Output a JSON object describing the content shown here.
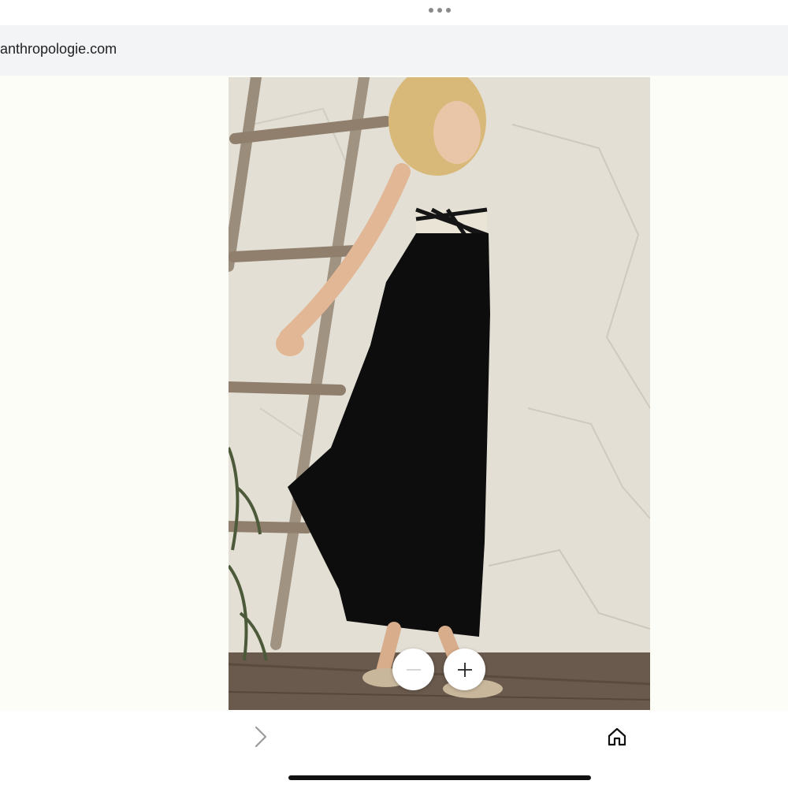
{
  "browser": {
    "url": "anthropologie.com",
    "menu_icon": "more-dots-icon"
  },
  "image_viewer": {
    "image_subject": "product-photo",
    "zoom_out_icon": "minus-icon",
    "zoom_in_icon": "plus-icon"
  },
  "toolbar": {
    "forward_icon": "chevron-right-icon",
    "home_icon": "home-icon"
  },
  "colors": {
    "url_bar_bg": "#f2f4f6",
    "viewer_bg": "#fdfdf8",
    "dress": "#0d0d0d",
    "wall": "#e4e0d7"
  }
}
